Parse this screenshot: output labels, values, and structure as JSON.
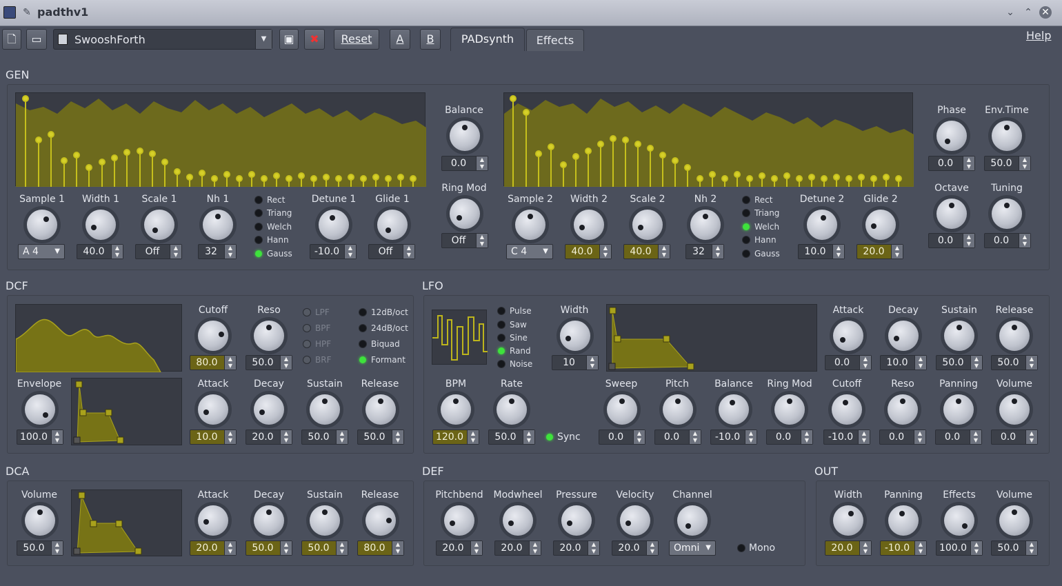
{
  "window": {
    "title": "padthv1"
  },
  "toolbar": {
    "preset": "SwooshForth",
    "reset": "Reset",
    "a": "A",
    "b": "B",
    "help": "Help"
  },
  "tabs": [
    "PADsynth",
    "Effects"
  ],
  "gen": {
    "title": "GEN",
    "osc1": {
      "sample": "A 4",
      "width": "40.0",
      "scale": "Off",
      "nh": "32",
      "detune": "-10.0",
      "glide": "Off"
    },
    "osc2": {
      "sample": "C 4",
      "width": "40.0",
      "scale": "40.0",
      "nh": "32",
      "detune": "10.0",
      "glide": "20.0"
    },
    "labels": {
      "sample1": "Sample 1",
      "width1": "Width 1",
      "scale1": "Scale 1",
      "nh1": "Nh 1",
      "detune1": "Detune 1",
      "glide1": "Glide 1",
      "sample2": "Sample 2",
      "width2": "Width 2",
      "scale2": "Scale 2",
      "nh2": "Nh 2",
      "detune2": "Detune 2",
      "glide2": "Glide 2",
      "balance": "Balance",
      "ringmod": "Ring Mod",
      "phase": "Phase",
      "envtime": "Env.Time",
      "octave": "Octave",
      "tuning": "Tuning"
    },
    "balance": "0.0",
    "ringmod": "Off",
    "phase": "0.0",
    "envtime": "50.0",
    "octave": "0.0",
    "tuning": "0.0",
    "shapes": [
      "Rect",
      "Triang",
      "Welch",
      "Hann",
      "Gauss"
    ],
    "osc1_shape": "Gauss",
    "osc2_shape": "Welch"
  },
  "dcf": {
    "title": "DCF",
    "labels": {
      "cutoff": "Cutoff",
      "reso": "Reso",
      "envelope": "Envelope",
      "attack": "Attack",
      "decay": "Decay",
      "sustain": "Sustain",
      "release": "Release"
    },
    "cutoff": "80.0",
    "reso": "50.0",
    "envelope": "100.0",
    "attack": "10.0",
    "decay": "20.0",
    "sustain": "50.0",
    "release": "50.0",
    "types": [
      "LPF",
      "BPF",
      "HPF",
      "BRF"
    ],
    "slopes": [
      "12dB/oct",
      "24dB/oct",
      "Biquad",
      "Formant"
    ],
    "slope": "Formant"
  },
  "lfo": {
    "title": "LFO",
    "labels": {
      "width": "Width",
      "bpm": "BPM",
      "rate": "Rate",
      "sync": "Sync",
      "attack": "Attack",
      "decay": "Decay",
      "sustain": "Sustain",
      "release": "Release",
      "sweep": "Sweep",
      "pitch": "Pitch",
      "balance": "Balance",
      "ringmod": "Ring Mod",
      "cutoff": "Cutoff",
      "reso": "Reso",
      "panning": "Panning",
      "volume": "Volume"
    },
    "shapes": [
      "Pulse",
      "Saw",
      "Sine",
      "Rand",
      "Noise"
    ],
    "shape": "Rand",
    "width": "10",
    "bpm": "120.0",
    "rate": "50.0",
    "attack": "0.0",
    "decay": "10.0",
    "sustain": "50.0",
    "release": "50.0",
    "sweep": "0.0",
    "pitch": "0.0",
    "balance": "-10.0",
    "ringmod": "0.0",
    "cutoff": "-10.0",
    "reso": "0.0",
    "panning": "0.0",
    "volume": "0.0"
  },
  "dca": {
    "title": "DCA",
    "labels": {
      "volume": "Volume",
      "attack": "Attack",
      "decay": "Decay",
      "sustain": "Sustain",
      "release": "Release"
    },
    "volume": "50.0",
    "attack": "20.0",
    "decay": "50.0",
    "sustain": "50.0",
    "release": "80.0"
  },
  "def": {
    "title": "DEF",
    "labels": {
      "pitchbend": "Pitchbend",
      "modwheel": "Modwheel",
      "pressure": "Pressure",
      "velocity": "Velocity",
      "channel": "Channel",
      "mono": "Mono"
    },
    "pitchbend": "20.0",
    "modwheel": "20.0",
    "pressure": "20.0",
    "velocity": "20.0",
    "channel": "Omni"
  },
  "out": {
    "title": "OUT",
    "labels": {
      "width": "Width",
      "panning": "Panning",
      "effects": "Effects",
      "volume": "Volume"
    },
    "width": "20.0",
    "panning": "-10.0",
    "effects": "100.0",
    "volume": "50.0"
  },
  "colors": {
    "background": "#4b505e",
    "accent": "#6b6416",
    "wave": "#8c8418",
    "led_on": "#3ee23c"
  }
}
